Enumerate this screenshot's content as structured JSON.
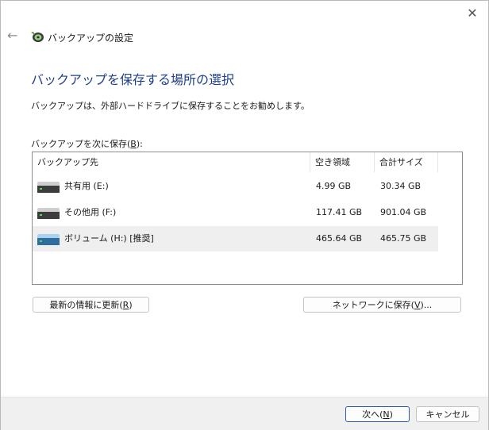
{
  "window": {
    "title": "バックアップの設定",
    "close_glyph": "✕",
    "back_glyph": "←"
  },
  "page": {
    "heading": "バックアップを保存する場所の選択",
    "description": "バックアップは、外部ハードドライブに保存することをお勧めします。",
    "list_label_prefix": "バックアップを次に保存(",
    "list_label_key": "B",
    "list_label_suffix": "):"
  },
  "table": {
    "columns": [
      "バックアップ先",
      "空き領域",
      "合計サイズ"
    ],
    "rows": [
      {
        "name": "共有用 (E:)",
        "free": "4.99 GB",
        "total": "30.34 GB",
        "icon": "drive-icon",
        "selected": false
      },
      {
        "name": "その他用 (F:)",
        "free": "117.41 GB",
        "total": "901.04 GB",
        "icon": "drive-icon",
        "selected": false
      },
      {
        "name": "ボリューム (H:) [推奨]",
        "free": "465.64 GB",
        "total": "465.75 GB",
        "icon": "drive-icon-blue",
        "selected": true
      }
    ]
  },
  "buttons": {
    "refresh_prefix": "最新の情報に更新(",
    "refresh_key": "R",
    "refresh_suffix": ")",
    "network_prefix": "ネットワークに保存(",
    "network_key": "V",
    "network_suffix": ")...",
    "next_prefix": "次へ(",
    "next_key": "N",
    "next_suffix": ")",
    "cancel": "キャンセル"
  },
  "colors": {
    "heading": "#1e3f8c",
    "selected_row": "#efefef",
    "footer": "#f0f0f0",
    "primary_border": "#2a5cb8"
  }
}
